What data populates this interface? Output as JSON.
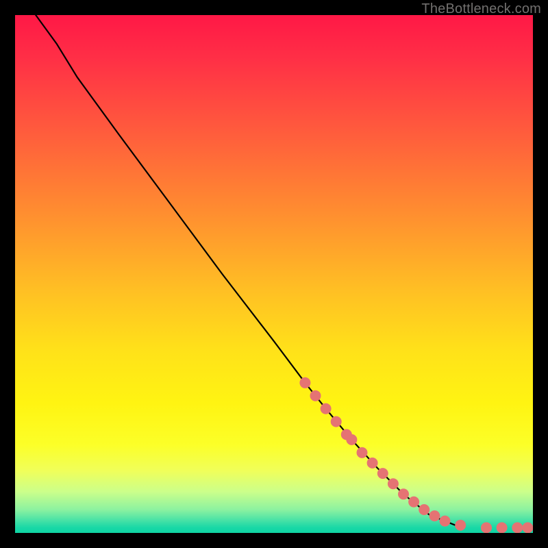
{
  "watermark": "TheBottleneck.com",
  "chart_data": {
    "type": "line",
    "title": "",
    "xlabel": "",
    "ylabel": "",
    "xlim": [
      0,
      100
    ],
    "ylim": [
      0,
      100
    ],
    "grid": false,
    "series": [
      {
        "name": "curve",
        "style": "line",
        "color": "#000000",
        "x": [
          4.0,
          8.0,
          12.0,
          20.0,
          30.0,
          40.0,
          50.0,
          56.0,
          60.0,
          65.0,
          70.0,
          75.0,
          80.0,
          85.0,
          86.0
        ],
        "y": [
          100.0,
          94.5,
          88.0,
          77.0,
          63.5,
          50.0,
          37.0,
          29.0,
          24.0,
          18.0,
          12.5,
          7.5,
          3.5,
          1.5,
          1.5
        ]
      },
      {
        "name": "markers",
        "style": "points",
        "color": "#e57373",
        "x": [
          56.0,
          58.0,
          60.0,
          62.0,
          64.0,
          65.0,
          67.0,
          69.0,
          71.0,
          73.0,
          75.0,
          77.0,
          79.0,
          81.0,
          83.0,
          86.0,
          91.0,
          94.0,
          97.0,
          99.0
        ],
        "y": [
          29.0,
          26.5,
          24.0,
          21.5,
          19.0,
          18.0,
          15.5,
          13.5,
          11.5,
          9.5,
          7.5,
          6.0,
          4.5,
          3.3,
          2.3,
          1.5,
          1.0,
          1.0,
          1.0,
          1.0
        ]
      }
    ],
    "legend": false
  }
}
